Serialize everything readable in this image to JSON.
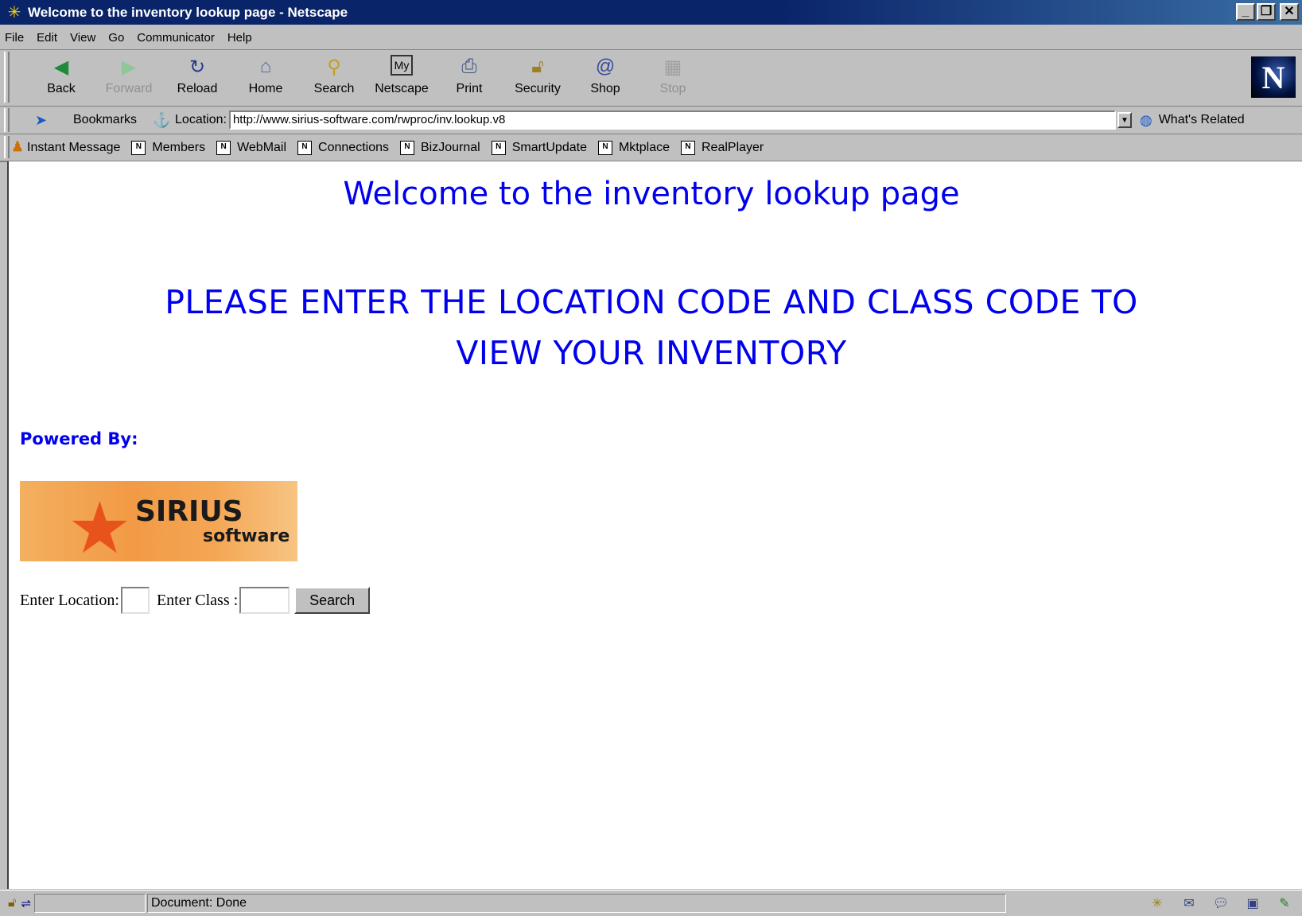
{
  "window": {
    "title": "Welcome to the inventory lookup page - Netscape"
  },
  "menu": [
    "File",
    "Edit",
    "View",
    "Go",
    "Communicator",
    "Help"
  ],
  "nav": {
    "back": "Back",
    "forward": "Forward",
    "reload": "Reload",
    "home": "Home",
    "search": "Search",
    "netscape": "Netscape",
    "print": "Print",
    "security": "Security",
    "shop": "Shop",
    "stop": "Stop"
  },
  "location": {
    "bookmarks": "Bookmarks",
    "label": "Location:",
    "url": "http://www.sirius-software.com/rwproc/inv.lookup.v8",
    "whats_related": "What's Related"
  },
  "personal": [
    "Instant Message",
    "Members",
    "WebMail",
    "Connections",
    "BizJournal",
    "SmartUpdate",
    "Mktplace",
    "RealPlayer"
  ],
  "page": {
    "heading": "Welcome to the inventory lookup page",
    "instruction_line1": "PLEASE ENTER THE LOCATION CODE AND CLASS CODE TO",
    "instruction_line2": "VIEW YOUR INVENTORY",
    "powered_by": "Powered By:",
    "logo_main": "SIRIUS",
    "logo_sub": "software",
    "location_label": "Enter Location:",
    "location_value": "",
    "class_label": "Enter Class :",
    "class_value": "",
    "search_button": "Search"
  },
  "status": {
    "text": "Document: Done"
  }
}
